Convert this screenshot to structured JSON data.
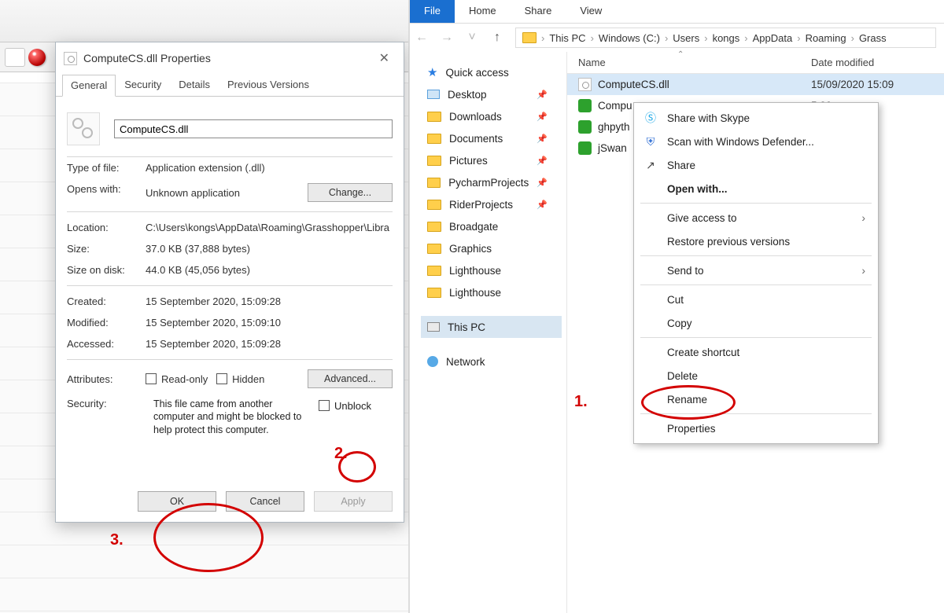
{
  "dialog": {
    "title": "ComputeCS.dll Properties",
    "tabs": {
      "general": "General",
      "security": "Security",
      "details": "Details",
      "prev": "Previous Versions"
    },
    "filename": "ComputeCS.dll",
    "labels": {
      "type": "Type of file:",
      "opens": "Opens with:",
      "change": "Change...",
      "location": "Location:",
      "size": "Size:",
      "sod": "Size on disk:",
      "created": "Created:",
      "modified": "Modified:",
      "accessed": "Accessed:",
      "attributes": "Attributes:",
      "readonly": "Read-only",
      "hidden": "Hidden",
      "advanced": "Advanced...",
      "security": "Security:",
      "unblock": "Unblock",
      "ok": "OK",
      "cancel": "Cancel",
      "apply": "Apply"
    },
    "values": {
      "type": "Application extension (.dll)",
      "opens": "Unknown application",
      "location": "C:\\Users\\kongs\\AppData\\Roaming\\Grasshopper\\Libra",
      "size": "37.0 KB (37,888 bytes)",
      "sod": "44.0 KB (45,056 bytes)",
      "created": "15 September 2020, 15:09:28",
      "modified": "15 September 2020, 15:09:10",
      "accessed": "15 September 2020, 15:09:28",
      "security_msg": "This file came from another computer and might be blocked to help protect this computer."
    }
  },
  "explorer": {
    "ribbon": {
      "file": "File",
      "home": "Home",
      "share": "Share",
      "view": "View"
    },
    "crumbs": [
      "This PC",
      "Windows (C:)",
      "Users",
      "kongs",
      "AppData",
      "Roaming",
      "Grass"
    ],
    "cols": {
      "name": "Name",
      "modified": "Date modified"
    },
    "nav": {
      "quick": "Quick access",
      "desktop": "Desktop",
      "downloads": "Downloads",
      "documents": "Documents",
      "pictures": "Pictures",
      "pych": "PycharmProjects",
      "rider": "RiderProjects",
      "broad": "Broadgate",
      "graphics": "Graphics",
      "light1": "Lighthouse",
      "light2": "Lighthouse",
      "thispc": "This PC",
      "network": "Network"
    },
    "files": [
      {
        "name": "ComputeCS.dll",
        "date": "15/09/2020 15:09",
        "kind": "dll",
        "sel": true
      },
      {
        "name": "Compu",
        "date": "5:09",
        "kind": "gha"
      },
      {
        "name": "ghpyth",
        "date": "2:09",
        "kind": "gha"
      },
      {
        "name": "jSwan",
        "date": "3:01",
        "kind": "gha"
      }
    ]
  },
  "context_menu": {
    "skype": "Share with Skype",
    "defender": "Scan with Windows Defender...",
    "share": "Share",
    "openwith": "Open with...",
    "giveaccess": "Give access to",
    "restore": "Restore previous versions",
    "sendto": "Send to",
    "cut": "Cut",
    "copy": "Copy",
    "shortcut": "Create shortcut",
    "delete": "Delete",
    "rename": "Rename",
    "properties": "Properties"
  },
  "annotations": {
    "one": "1.",
    "two": "2.",
    "three": "3."
  }
}
